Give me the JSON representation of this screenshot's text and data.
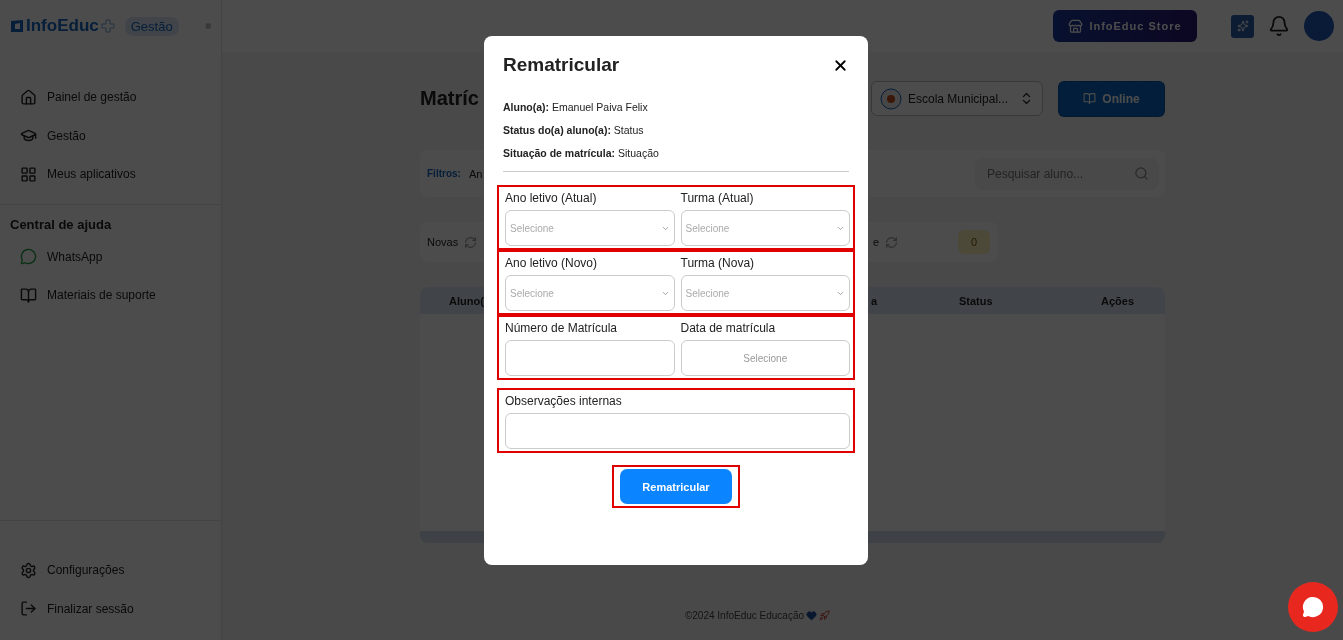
{
  "header": {
    "logo": "InfoEduc",
    "module_badge": "Gestão",
    "store_button": "InfoEduc Store"
  },
  "sidebar": {
    "items": [
      {
        "label": "Painel de gestão"
      },
      {
        "label": "Gestão"
      },
      {
        "label": "Meus aplicativos"
      }
    ],
    "help_title": "Central de ajuda",
    "help_items": [
      {
        "label": "WhatsApp"
      },
      {
        "label": "Materiais de suporte"
      }
    ],
    "footer_items": [
      {
        "label": "Configurações"
      },
      {
        "label": "Finalizar sessão"
      }
    ]
  },
  "page": {
    "title": "Matríc",
    "school_select": "Escola Municipal...",
    "online_button": "Online",
    "filters_label": "Filtros:",
    "filter_value": "An",
    "search": {
      "placeholder": "Pesquisar aluno..."
    },
    "stats": {
      "left_label": "Novas",
      "right_label": "e",
      "right_count": "0"
    },
    "table": {
      "columns": [
        "Aluno(",
        "a",
        "Status",
        "Ações"
      ]
    },
    "footer": "©2024 InfoEduc Educação"
  },
  "modal": {
    "title": "Rematricular",
    "info": [
      "**Aluno(a):** Emanuel Paiva Felix",
      "**Status do(a) aluno(a):** Status",
      "**Situação de matrícula:** Situação"
    ],
    "sections": [
      {
        "highlighted": true,
        "fields": [
          {
            "label": "Ano letivo (Atual)",
            "kind": "select",
            "placeholder": "Selecione"
          },
          {
            "label": "Turma (Atual)",
            "kind": "select",
            "placeholder": "Selecione"
          }
        ]
      },
      {
        "highlighted": true,
        "fields": [
          {
            "label": "Ano letivo (Novo)",
            "kind": "select",
            "placeholder": "Selecione"
          },
          {
            "label": "Turma (Nova)",
            "kind": "select",
            "placeholder": "Selecione"
          }
        ]
      },
      {
        "highlighted": true,
        "fields": [
          {
            "label": "Número de Matrícula",
            "kind": "text"
          },
          {
            "label": "Data de matrícula",
            "kind": "date",
            "placeholder": "Selecione"
          }
        ]
      },
      {
        "highlighted": true,
        "fields": [
          {
            "label": "Observações internas",
            "kind": "text"
          }
        ]
      }
    ],
    "submit": {
      "label": "Rematricular",
      "highlighted": true
    }
  }
}
